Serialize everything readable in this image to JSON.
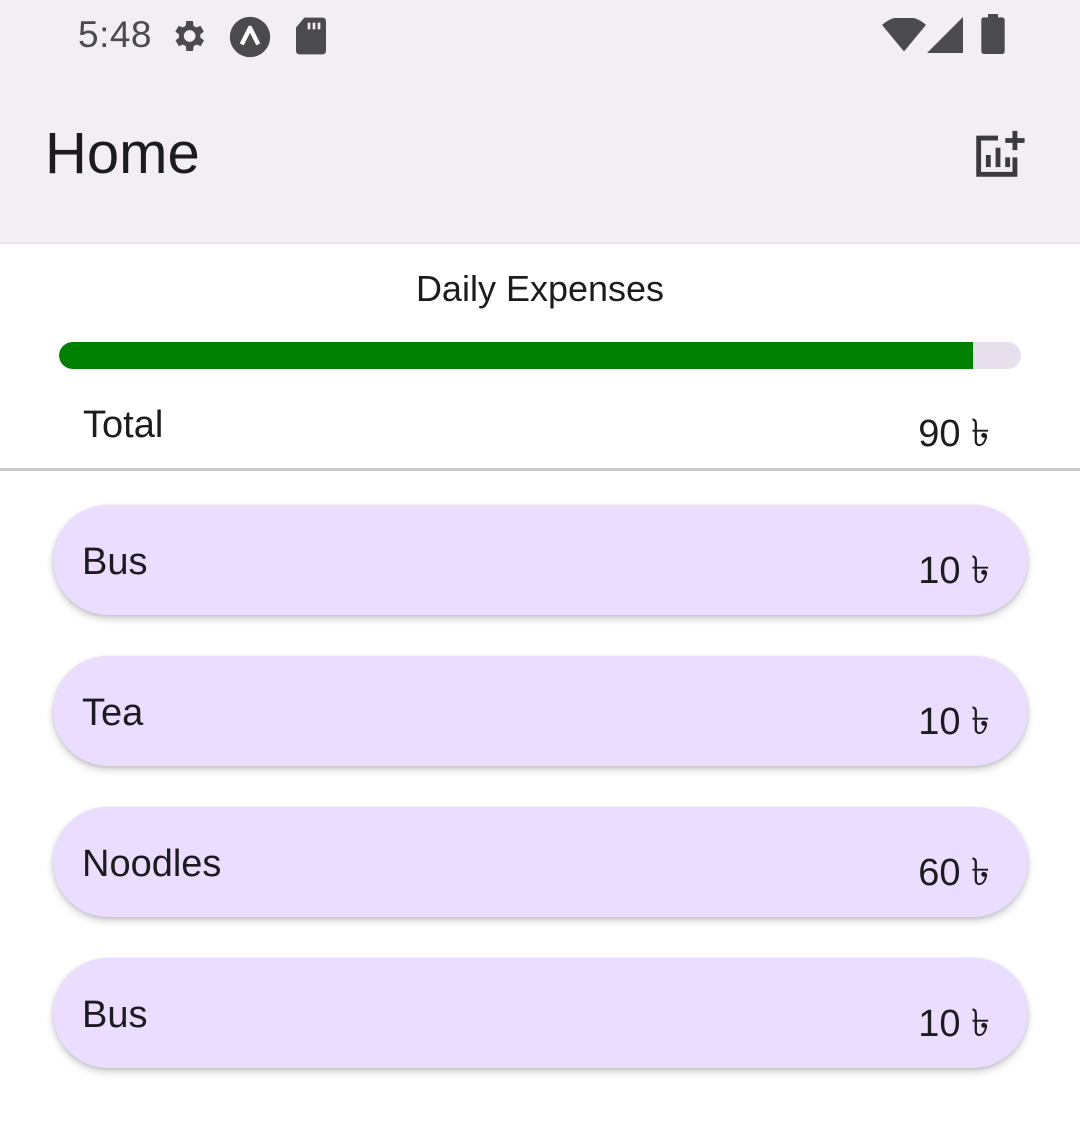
{
  "status_bar": {
    "time": "5:48",
    "icons": [
      "gear-icon",
      "app-a-icon",
      "sd-card-icon",
      "wifi-icon",
      "cell-signal-icon",
      "battery-icon"
    ]
  },
  "app_bar": {
    "title": "Home",
    "action_icon": "add-chart-icon"
  },
  "summary": {
    "title": "Daily Expenses",
    "progress_fraction": 0.95,
    "progress_color": "#008000",
    "total_label": "Total",
    "total_value": "90 ৳"
  },
  "expenses": [
    {
      "name": "Bus",
      "amount": "10 ৳"
    },
    {
      "name": "Tea",
      "amount": "10 ৳"
    },
    {
      "name": "Noodles",
      "amount": "60 ৳"
    },
    {
      "name": "Bus",
      "amount": "10 ৳"
    }
  ],
  "colors": {
    "bar_background": "#f3edf4",
    "card_background": "#eaddff",
    "progress_track": "#e7e0ec"
  }
}
